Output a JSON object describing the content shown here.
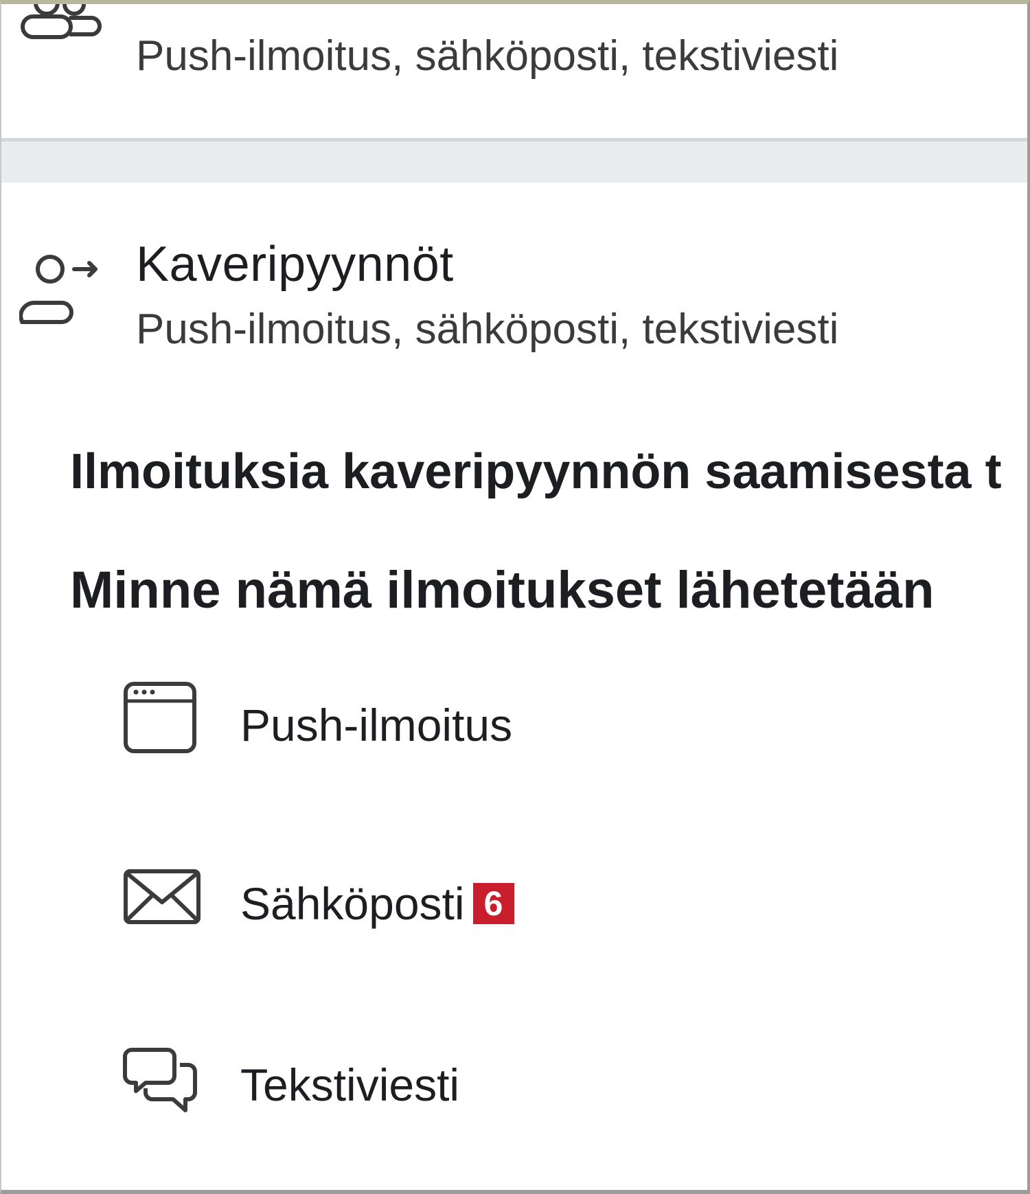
{
  "rows": [
    {
      "title": "",
      "subtitle": "Push-ilmoitus, sähköposti, tekstiviesti",
      "icon": "group-icon"
    },
    {
      "title": "Kaveripyynnöt",
      "subtitle": "Push-ilmoitus, sähköposti, tekstiviesti",
      "icon": "friend-request-icon"
    }
  ],
  "section": {
    "description": "Ilmoituksia kaveripyynnön saamisesta t",
    "channels_heading": "Minne nämä ilmoitukset lähetetään"
  },
  "channels": [
    {
      "label": "Push-ilmoitus",
      "icon": "browser-window-icon"
    },
    {
      "label": "Sähköposti",
      "icon": "envelope-icon",
      "badge": "6"
    },
    {
      "label": "Tekstiviesti",
      "icon": "chat-bubbles-icon"
    }
  ],
  "colors": {
    "badge": "#c81e2e",
    "divider": "#e9edf0"
  }
}
